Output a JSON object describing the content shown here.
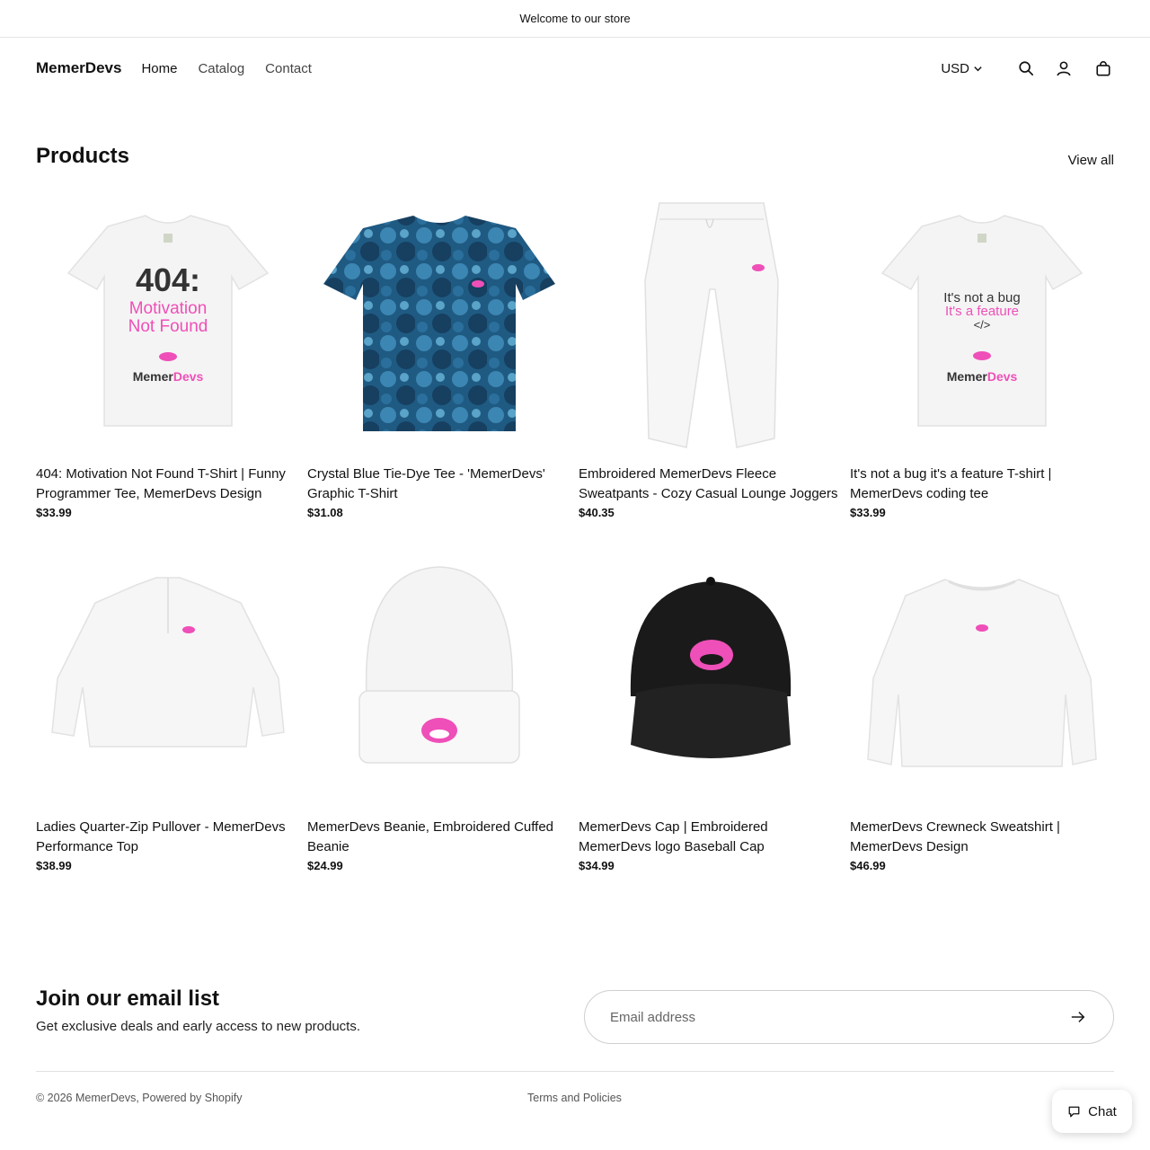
{
  "announcement": "Welcome to our store",
  "header": {
    "brand": "MemerDevs",
    "nav": [
      "Home",
      "Catalog",
      "Contact"
    ],
    "currency": "USD"
  },
  "products_section": {
    "title": "Products",
    "view_all": "View all",
    "items": [
      {
        "title": "404: Motivation Not Found T-Shirt | Funny Programmer Tee, MemerDevs Design",
        "price": "$33.99",
        "image": "white-tshirt-404",
        "print": {
          "big": "404:",
          "pink1": "Motivation",
          "pink2": "Not Found",
          "brand_a": "Memer",
          "brand_b": "Devs"
        }
      },
      {
        "title": "Crystal Blue Tie-Dye Tee - 'MemerDevs' Graphic T-Shirt",
        "price": "$31.08",
        "image": "blue-tie-dye-tshirt"
      },
      {
        "title": "Embroidered MemerDevs Fleece Sweatpants - Cozy Casual Lounge Joggers",
        "price": "$40.35",
        "image": "white-sweatpants"
      },
      {
        "title": "It's not a bug it's a feature T-shirt | MemerDevs coding tee",
        "price": "$33.99",
        "image": "white-tshirt-bug-feature",
        "print": {
          "line1": "It's not a bug",
          "line2": "It's a feature",
          "line3": "</>",
          "brand_a": "Memer",
          "brand_b": "Devs"
        }
      },
      {
        "title": "Ladies Quarter-Zip Pullover - MemerDevs Performance Top",
        "price": "$38.99",
        "image": "white-quarter-zip"
      },
      {
        "title": "MemerDevs Beanie, Embroidered Cuffed Beanie",
        "price": "$24.99",
        "image": "white-beanie"
      },
      {
        "title": "MemerDevs Cap | Embroidered MemerDevs logo Baseball Cap",
        "price": "$34.99",
        "image": "black-cap"
      },
      {
        "title": "MemerDevs Crewneck Sweatshirt | MemerDevs Design",
        "price": "$46.99",
        "image": "white-crewneck"
      }
    ]
  },
  "newsletter": {
    "title": "Join our email list",
    "subtitle": "Get exclusive deals and early access to new products.",
    "placeholder": "Email address"
  },
  "footer": {
    "copyright": "© 2026 MemerDevs, Powered by Shopify",
    "terms": "Terms and Policies"
  },
  "chat": {
    "label": "Chat"
  },
  "colors": {
    "accent_pink": "#ef4fb8",
    "tie_dye_blue": "#1f5a82",
    "cap_black": "#1a1a1a"
  }
}
